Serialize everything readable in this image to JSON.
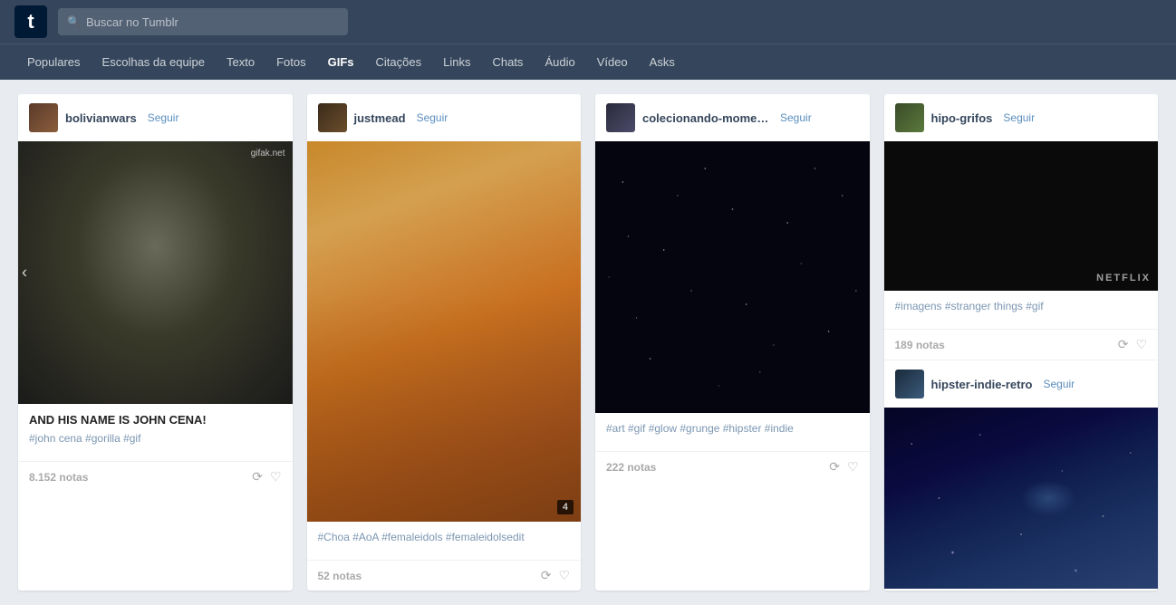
{
  "app": {
    "logo": "t",
    "search": {
      "placeholder": "Buscar no Tumblr"
    }
  },
  "nav": {
    "items": [
      {
        "label": "Populares",
        "active": false
      },
      {
        "label": "Escolhas da equipe",
        "active": false
      },
      {
        "label": "Texto",
        "active": false
      },
      {
        "label": "Fotos",
        "active": false
      },
      {
        "label": "GIFs",
        "active": true
      },
      {
        "label": "Citações",
        "active": false
      },
      {
        "label": "Links",
        "active": false
      },
      {
        "label": "Chats",
        "active": false
      },
      {
        "label": "Áudio",
        "active": false
      },
      {
        "label": "Vídeo",
        "active": false
      },
      {
        "label": "Asks",
        "active": false
      }
    ]
  },
  "posts": [
    {
      "id": "post1",
      "username": "bolivianwars",
      "follow_label": "Seguir",
      "title": "AND HIS NAME IS JOHN CENA!",
      "tags": "#john cena  #gorilla  #gif",
      "notes": "8.152 notas",
      "watermark": "gifak.net",
      "image_type": "gorilla"
    },
    {
      "id": "post2",
      "username": "justmead",
      "follow_label": "Seguir",
      "tags": "#Choa  #AoA  #femaleidols  #femaleidolsedit",
      "notes": "52 notas",
      "badge": "4",
      "image_type": "singer"
    },
    {
      "id": "post3",
      "username": "colecionando-moment...",
      "follow_label": "Seguir",
      "tags": "#art  #gif  #glow  #grunge  #hipster  #indie",
      "notes": "222 notas",
      "image_type": "stars"
    },
    {
      "id": "post4",
      "username": "hipo-grifos",
      "follow_label": "Seguir",
      "tags": "#imagens  #stranger things  #gif",
      "notes": "189 notas",
      "image_type": "netflix",
      "sub_post": {
        "username": "hipster-indie-retro",
        "follow_label": "Seguir",
        "image_type": "galaxy"
      }
    }
  ],
  "icons": {
    "search": "🔍",
    "reblog": "🔁",
    "heart": "♡",
    "prev_arrow": "‹"
  }
}
